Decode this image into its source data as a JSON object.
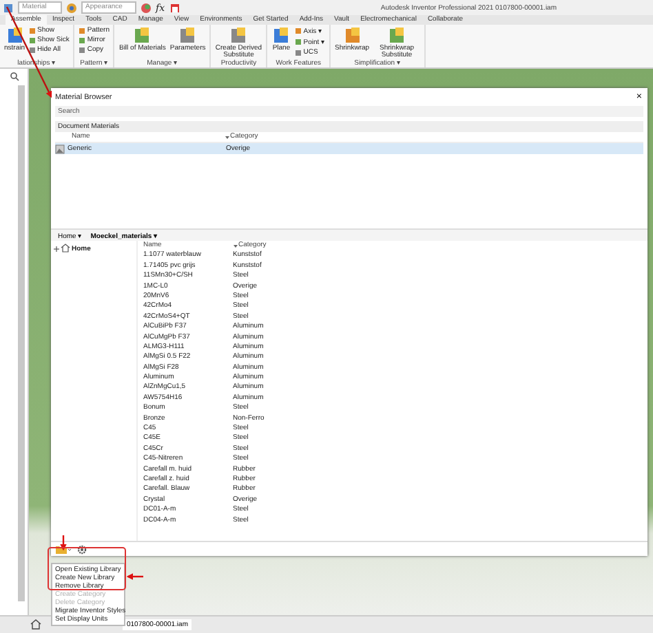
{
  "title_bar": {
    "material_field": "Material",
    "appearance_field": "Appearance",
    "fx": "fx",
    "title": "Autodesk Inventor Professional 2021   0107800-00001.iam"
  },
  "ribbon_tabs": [
    {
      "label": "Assemble",
      "selected": true
    },
    {
      "label": "Inspect",
      "selected": false
    },
    {
      "label": "Tools",
      "selected": false
    },
    {
      "label": "CAD",
      "selected": false
    },
    {
      "label": "Manage",
      "selected": false
    },
    {
      "label": "View",
      "selected": false
    },
    {
      "label": "Environments",
      "selected": false
    },
    {
      "label": "Get Started",
      "selected": false
    },
    {
      "label": "Add-Ins",
      "selected": false
    },
    {
      "label": "Vault",
      "selected": false
    },
    {
      "label": "Electromechanical",
      "selected": false
    },
    {
      "label": "Collaborate",
      "selected": false
    }
  ],
  "ribbon_groups": [
    {
      "label": "lationships ▾",
      "items": [
        {
          "kind": "large",
          "label": "nstrain"
        },
        {
          "kind": "small",
          "label": "Show"
        },
        {
          "kind": "small",
          "label": "Show Sick"
        },
        {
          "kind": "small",
          "label": "Hide All"
        }
      ]
    },
    {
      "label": "Pattern ▾",
      "items": [
        {
          "kind": "small",
          "label": "Pattern"
        },
        {
          "kind": "small",
          "label": "Mirror"
        },
        {
          "kind": "small",
          "label": "Copy"
        }
      ]
    },
    {
      "label": "Manage ▾",
      "items": [
        {
          "kind": "large",
          "label": "Bill of Materials"
        },
        {
          "kind": "large",
          "label": "Parameters"
        }
      ]
    },
    {
      "label": "Productivity",
      "items": [
        {
          "kind": "large",
          "label": "Create Derived Substitute"
        }
      ]
    },
    {
      "label": "Work Features",
      "items": [
        {
          "kind": "large",
          "label": "Plane"
        },
        {
          "kind": "small",
          "label": "Axis ▾"
        },
        {
          "kind": "small",
          "label": "Point ▾"
        },
        {
          "kind": "small",
          "label": "UCS"
        }
      ]
    },
    {
      "label": "Simplification ▾",
      "items": [
        {
          "kind": "large",
          "label": "Shrinkwrap"
        },
        {
          "kind": "large",
          "label": "Shrinkwrap Substitute"
        }
      ]
    }
  ],
  "material_browser": {
    "title": "Material Browser",
    "close": "×",
    "search": {
      "placeholder": "Search"
    },
    "document_materials": {
      "heading": "Document Materials",
      "columns": [
        "Name",
        "Category"
      ],
      "rows": [
        {
          "name": "Generic",
          "category": "Overige",
          "selected": true
        }
      ]
    },
    "breadcrumb": [
      "Home ▾",
      "Moeckel_materials ▾"
    ],
    "tree": [
      {
        "label": "Home",
        "expanded": false
      }
    ],
    "library": {
      "columns": [
        "Name",
        "Category"
      ],
      "rows": [
        {
          "name": "1.1077 waterblauw",
          "category": "Kunststof"
        },
        {
          "name": "1.71405 pvc grijs",
          "category": "Kunststof"
        },
        {
          "name": "11SMn30+C/SH",
          "category": "Steel"
        },
        {
          "name": "1MC-L0",
          "category": "Overige"
        },
        {
          "name": "20MnV6",
          "category": "Steel"
        },
        {
          "name": "42CrMo4",
          "category": "Steel"
        },
        {
          "name": "42CrMoS4+QT",
          "category": "Steel"
        },
        {
          "name": "AlCuBiPb F37",
          "category": "Aluminum"
        },
        {
          "name": "AlCuMgPb F37",
          "category": "Aluminum"
        },
        {
          "name": "ALMG3-H111",
          "category": "Aluminum"
        },
        {
          "name": "AlMgSi 0.5 F22",
          "category": "Aluminum"
        },
        {
          "name": "AlMgSi F28",
          "category": "Aluminum"
        },
        {
          "name": "Aluminum",
          "category": "Aluminum"
        },
        {
          "name": "AlZnMgCu1,5",
          "category": "Aluminum"
        },
        {
          "name": "AW5754H16",
          "category": "Aluminum"
        },
        {
          "name": "Bonum",
          "category": "Steel"
        },
        {
          "name": "Bronze",
          "category": "Non-Ferro"
        },
        {
          "name": "C45",
          "category": "Steel"
        },
        {
          "name": "C45E",
          "category": "Steel"
        },
        {
          "name": "C45Cr",
          "category": "Steel"
        },
        {
          "name": "C45-Nitreren",
          "category": "Steel"
        },
        {
          "name": "Carefall m. huid",
          "category": "Rubber"
        },
        {
          "name": "Carefall z. huid",
          "category": "Rubber"
        },
        {
          "name": "Carefall. Blauw",
          "category": "Rubber"
        },
        {
          "name": "Crystal",
          "category": "Overige"
        },
        {
          "name": "DC01-A-m",
          "category": "Steel"
        },
        {
          "name": "DC04-A-m",
          "category": "Steel"
        }
      ]
    }
  },
  "library_menu": [
    {
      "label": "Open Existing Library",
      "disabled": false
    },
    {
      "label": "Create New Library",
      "disabled": false
    },
    {
      "label": "Remove Library",
      "disabled": false
    },
    {
      "label": "Create Category",
      "disabled": true
    },
    {
      "label": "Delete Category",
      "disabled": true
    },
    {
      "label": "Migrate Inventor Styles",
      "disabled": false
    },
    {
      "label": "Set Display Units",
      "disabled": false
    }
  ],
  "status_bar": {
    "document_tab": "0107800-00001.iam"
  }
}
